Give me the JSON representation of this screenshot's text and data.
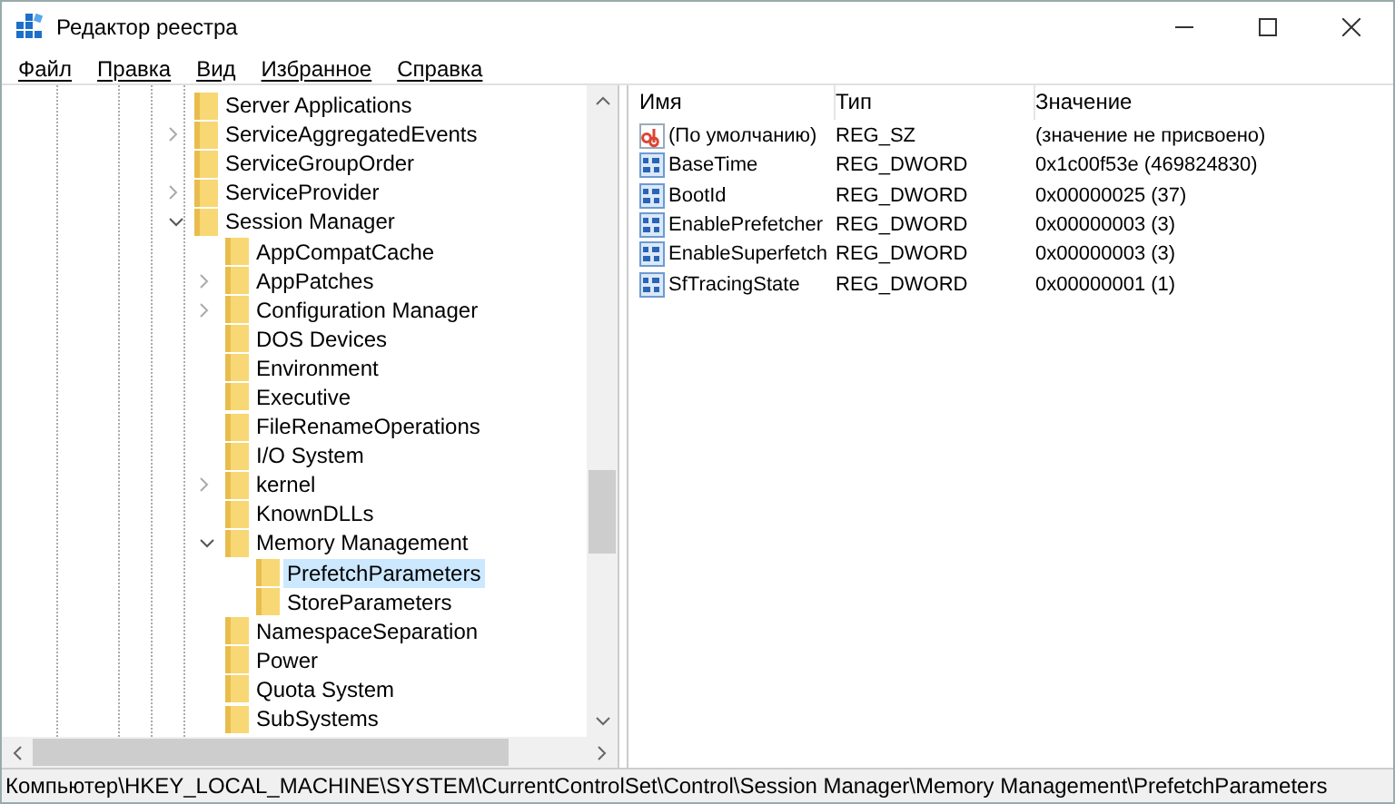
{
  "window": {
    "title": "Редактор реестра"
  },
  "menu": [
    "Файл",
    "Правка",
    "Вид",
    "Избранное",
    "Справка"
  ],
  "tree": [
    {
      "label": "Server Applications",
      "selected": false
    },
    {
      "label": "ServiceAggregatedEvents",
      "expanded": false,
      "selected": false
    },
    {
      "label": "ServiceGroupOrder",
      "selected": false
    },
    {
      "label": "ServiceProvider",
      "expanded": false,
      "selected": false
    },
    {
      "label": "Session Manager",
      "expanded": true,
      "selected": false,
      "children": [
        {
          "label": "AppCompatCache",
          "selected": false
        },
        {
          "label": "AppPatches",
          "expanded": false,
          "selected": false
        },
        {
          "label": "Configuration Manager",
          "expanded": false,
          "selected": false
        },
        {
          "label": "DOS Devices",
          "selected": false
        },
        {
          "label": "Environment",
          "selected": false
        },
        {
          "label": "Executive",
          "selected": false
        },
        {
          "label": "FileRenameOperations",
          "selected": false
        },
        {
          "label": "I/O System",
          "selected": false
        },
        {
          "label": "kernel",
          "expanded": false,
          "selected": false
        },
        {
          "label": "KnownDLLs",
          "selected": false
        },
        {
          "label": "Memory Management",
          "expanded": true,
          "selected": false,
          "children": [
            {
              "label": "PrefetchParameters",
              "selected": true
            },
            {
              "label": "StoreParameters",
              "selected": false
            }
          ]
        },
        {
          "label": "NamespaceSeparation",
          "selected": false
        },
        {
          "label": "Power",
          "selected": false
        },
        {
          "label": "Quota System",
          "selected": false
        },
        {
          "label": "SubSystems",
          "selected": false
        }
      ]
    }
  ],
  "table": {
    "columns": [
      "Имя",
      "Тип",
      "Значение"
    ],
    "rows": [
      {
        "kind": "string",
        "name": "(По умолчанию)",
        "type": "REG_SZ",
        "value": "(значение не присвоено)"
      },
      {
        "kind": "binary",
        "name": "BaseTime",
        "type": "REG_DWORD",
        "value": "0x1c00f53e (469824830)"
      },
      {
        "kind": "binary",
        "name": "BootId",
        "type": "REG_DWORD",
        "value": "0x00000025 (37)"
      },
      {
        "kind": "binary",
        "name": "EnablePrefetcher",
        "type": "REG_DWORD",
        "value": "0x00000003 (3)"
      },
      {
        "kind": "binary",
        "name": "EnableSuperfetch",
        "type": "REG_DWORD",
        "value": "0x00000003 (3)"
      },
      {
        "kind": "binary",
        "name": "SfTracingState",
        "type": "REG_DWORD",
        "value": "0x00000001 (1)"
      }
    ]
  },
  "status_bar": "Компьютер\\HKEY_LOCAL_MACHINE\\SYSTEM\\CurrentControlSet\\Control\\Session Manager\\Memory Management\\PrefetchParameters"
}
